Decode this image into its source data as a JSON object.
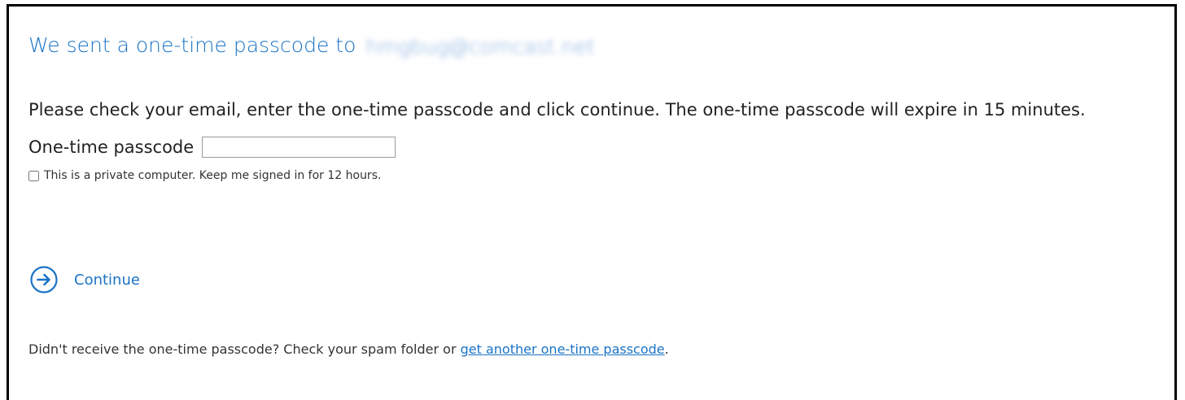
{
  "heading": {
    "text": "We sent a one-time passcode to",
    "email": "hmgbug@comcast.net"
  },
  "instructions": "Please check your email, enter the one-time passcode and click continue. The one-time passcode will expire in 15 minutes.",
  "otp": {
    "label": "One-time passcode",
    "value": "",
    "placeholder": ""
  },
  "remember": {
    "label": "This is a private computer. Keep me signed in for 12 hours.",
    "checked": false
  },
  "continue": {
    "label": "Continue",
    "icon": "arrow-right-circle-icon"
  },
  "footer": {
    "text": "Didn't receive the one-time passcode? Check your spam folder or",
    "link_text": "get another one-time passcode",
    "suffix": "."
  },
  "colors": {
    "accent": "#1a73c6",
    "text": "#222222",
    "frame": "#000000"
  }
}
